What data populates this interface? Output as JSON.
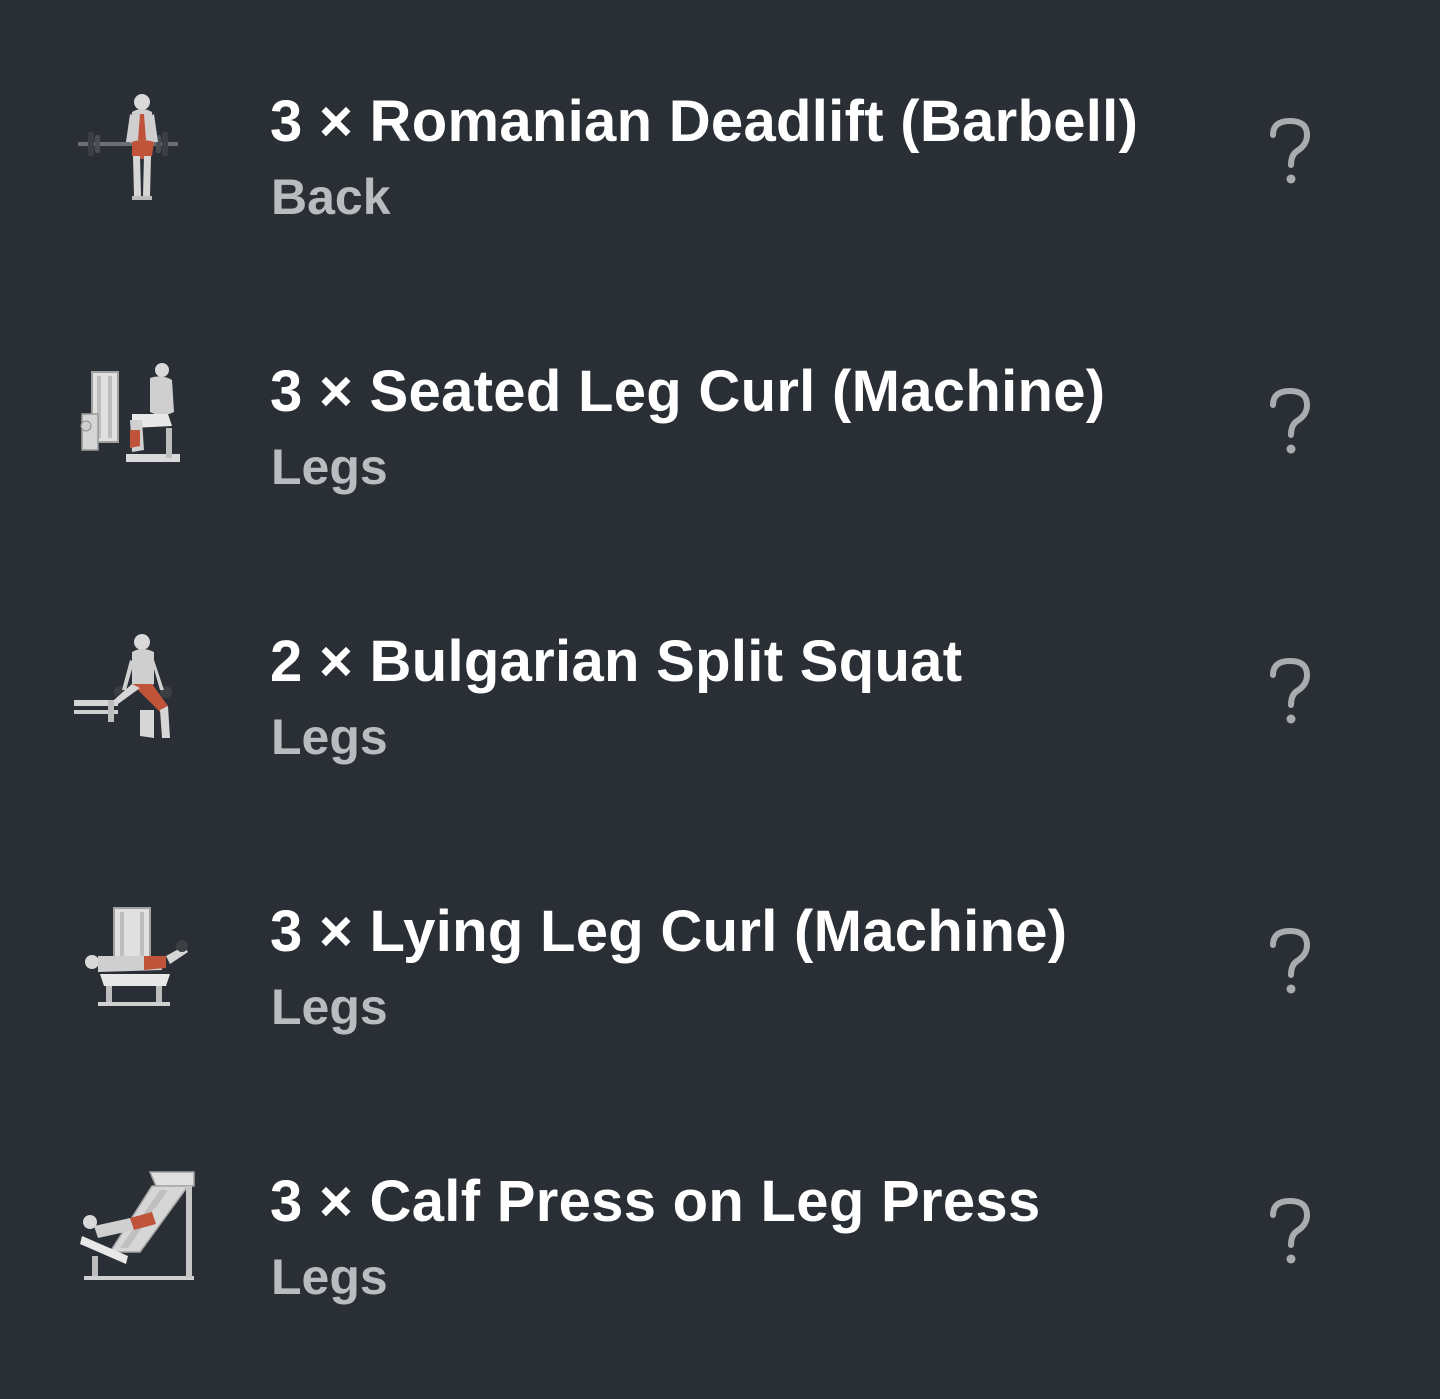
{
  "exercises": [
    {
      "sets": "3",
      "times": "×",
      "title": "3 × Romanian Deadlift (Barbell)",
      "category": "Back",
      "thumbnail_icon": "barbell-deadlift-figure-icon",
      "help_icon": "question-mark-icon"
    },
    {
      "sets": "3",
      "times": "×",
      "title": "3 × Seated Leg Curl (Machine)",
      "category": "Legs",
      "thumbnail_icon": "seated-leg-curl-machine-icon",
      "help_icon": "question-mark-icon"
    },
    {
      "sets": "2",
      "times": "×",
      "title": "2 × Bulgarian Split Squat",
      "category": "Legs",
      "thumbnail_icon": "split-squat-figure-icon",
      "help_icon": "question-mark-icon"
    },
    {
      "sets": "3",
      "times": "×",
      "title": "3 × Lying Leg Curl (Machine)",
      "category": "Legs",
      "thumbnail_icon": "lying-leg-curl-machine-icon",
      "help_icon": "question-mark-icon"
    },
    {
      "sets": "3",
      "times": "×",
      "title": "3 × Calf Press on Leg Press",
      "category": "Legs",
      "thumbnail_icon": "leg-press-machine-icon",
      "help_icon": "question-mark-icon"
    }
  ],
  "colors": {
    "background": "#2a2f35",
    "title": "#ffffff",
    "subtitle": "#b9bcbf",
    "help_icon": "#a9acaf",
    "muscle_highlight": "#c0543a"
  }
}
